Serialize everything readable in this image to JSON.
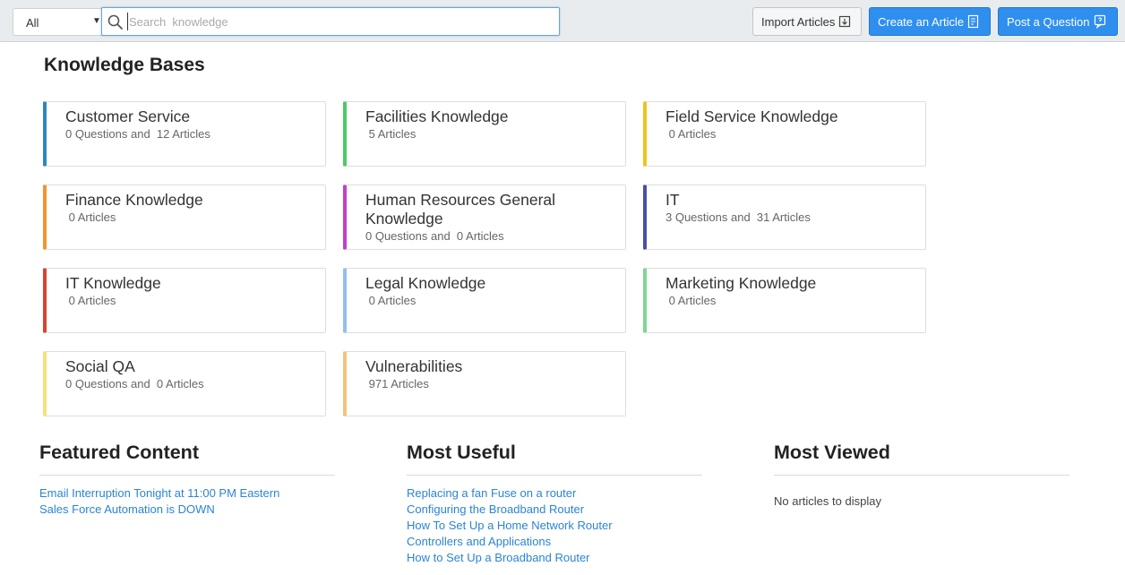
{
  "toolbar": {
    "scope_value": "All",
    "search_placeholder": "Search  knowledge",
    "import_label": "Import Articles",
    "create_label": "Create an Article",
    "post_label": "Post a Question"
  },
  "knowledge_bases": {
    "title": "Knowledge Bases",
    "items": [
      {
        "name": "Customer Service",
        "stats": "0 Questions and  12 Articles",
        "color": "#2e86c1"
      },
      {
        "name": "Facilities Knowledge",
        "stats": " 5 Articles",
        "color": "#4cc964"
      },
      {
        "name": "Field Service Knowledge",
        "stats": " 0 Articles",
        "color": "#f0c419"
      },
      {
        "name": "Finance Knowledge",
        "stats": " 0 Articles",
        "color": "#f0962e"
      },
      {
        "name": "Human Resources General Knowledge",
        "stats": "0 Questions and  0 Articles",
        "color": "#c43fcc"
      },
      {
        "name": "IT",
        "stats": "3 Questions and  31 Articles",
        "color": "#4a4fa3"
      },
      {
        "name": "IT Knowledge",
        "stats": " 0 Articles",
        "color": "#d5452f"
      },
      {
        "name": "Legal Knowledge",
        "stats": " 0 Articles",
        "color": "#8fc2ee"
      },
      {
        "name": "Marketing Knowledge",
        "stats": " 0 Articles",
        "color": "#7fd690"
      },
      {
        "name": "Social QA",
        "stats": "0 Questions and  0 Articles",
        "color": "#f5e27a"
      },
      {
        "name": "Vulnerabilities",
        "stats": " 971 Articles",
        "color": "#f4c27a"
      }
    ]
  },
  "featured": {
    "title": "Featured Content",
    "links": [
      "Email Interruption Tonight at 11:00 PM Eastern",
      "Sales Force Automation is DOWN"
    ]
  },
  "most_useful": {
    "title": "Most Useful",
    "links": [
      "Replacing a fan Fuse on a router",
      "Configuring the Broadband Router",
      "How To Set Up a Home Network Router",
      "Controllers and Applications",
      "How to Set Up a Broadband Router"
    ]
  },
  "most_viewed": {
    "title": "Most Viewed",
    "empty_text": "No articles to display"
  }
}
